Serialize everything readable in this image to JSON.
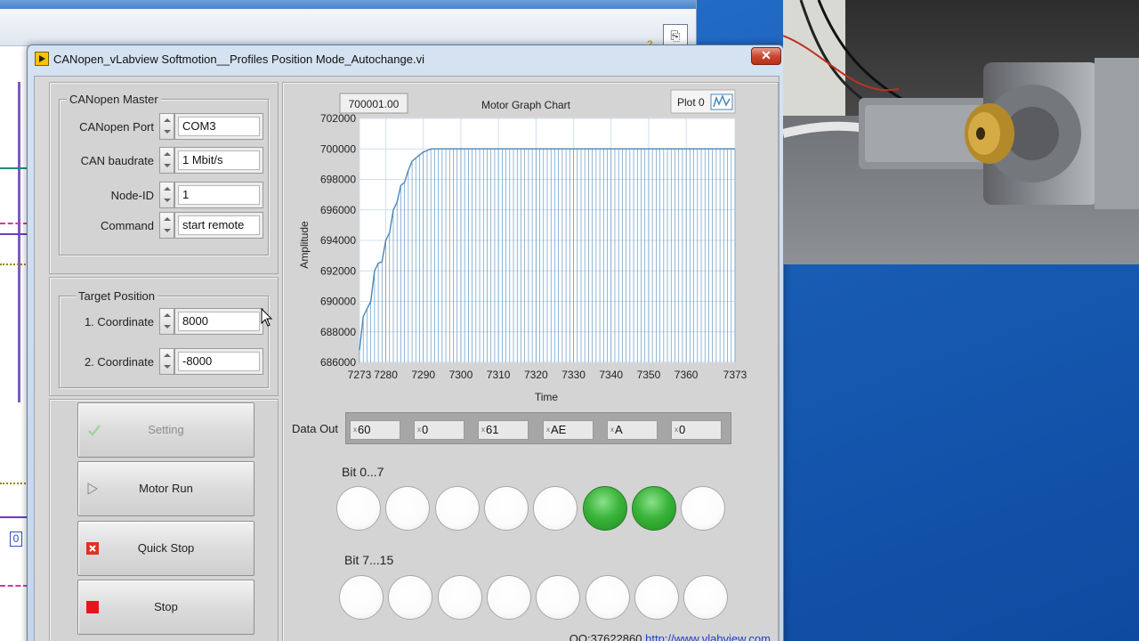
{
  "window": {
    "title": "CANopen_vLabview Softmotion__Profiles Position Mode_Autochange.vi",
    "close": "✕"
  },
  "background_window": {
    "zero_indicator": "0",
    "help_glyph": "?"
  },
  "master": {
    "group_title": "CANopen Master",
    "fields": [
      {
        "label": "CANopen Port",
        "value": "COM3"
      },
      {
        "label": "CAN baudrate",
        "value": "1 Mbit/s"
      },
      {
        "label": "Node-ID",
        "value": "1"
      },
      {
        "label": "Command",
        "value": "start remote"
      }
    ]
  },
  "target": {
    "group_title": "Target Position",
    "fields": [
      {
        "label": "1. Coordinate",
        "value": "8000"
      },
      {
        "label": "2. Coordinate",
        "value": "-8000"
      }
    ]
  },
  "buttons": {
    "setting": "Setting",
    "motor_run": "Motor Run",
    "quick_stop": "Quick Stop",
    "stop": "Stop"
  },
  "graph": {
    "current_value": "700001.00",
    "plot_legend": "Plot 0"
  },
  "chart_data": {
    "type": "line",
    "title": "Motor Graph Chart",
    "xlabel": "Time",
    "ylabel": "Amplitude",
    "xlim": [
      7273,
      7373
    ],
    "ylim": [
      686000,
      702000
    ],
    "xticks": [
      "7273",
      "7280",
      "7290",
      "7300",
      "7310",
      "7320",
      "7330",
      "7340",
      "7350",
      "7360",
      "7373"
    ],
    "yticks": [
      "702000",
      "700000",
      "698000",
      "696000",
      "694000",
      "692000",
      "690000",
      "688000",
      "686000"
    ],
    "grid": true,
    "series": [
      {
        "x": [
          7273,
          7274,
          7275,
          7276,
          7277,
          7278,
          7279,
          7280,
          7281,
          7282,
          7283,
          7284,
          7285,
          7286,
          7287,
          7288,
          7289,
          7290,
          7291,
          7292,
          7293,
          7300,
          7310,
          7320,
          7330,
          7340,
          7350,
          7360,
          7373
        ],
        "y": [
          686800,
          689000,
          689500,
          690000,
          692000,
          692500,
          692600,
          694000,
          694500,
          696000,
          696500,
          697600,
          697800,
          698600,
          699200,
          699400,
          699600,
          699800,
          699900,
          700000,
          700001,
          700001,
          700001,
          700001,
          700001,
          700001,
          700001,
          700001,
          700001
        ]
      }
    ],
    "color": "#4a86b8"
  },
  "data_out": {
    "label": "Data Out",
    "values": [
      "60",
      "0",
      "61",
      "AE",
      "A",
      "0"
    ],
    "radix_prefix": "x"
  },
  "bits_low": {
    "label": "Bit 0...7",
    "states": [
      false,
      false,
      false,
      false,
      false,
      true,
      true,
      false
    ]
  },
  "bits_high": {
    "label": "Bit 7...15",
    "states": [
      false,
      false,
      false,
      false,
      false,
      false,
      false,
      false
    ]
  },
  "footer": {
    "qq": "QQ:37622860",
    "link": "http://www.vlabview.com"
  }
}
